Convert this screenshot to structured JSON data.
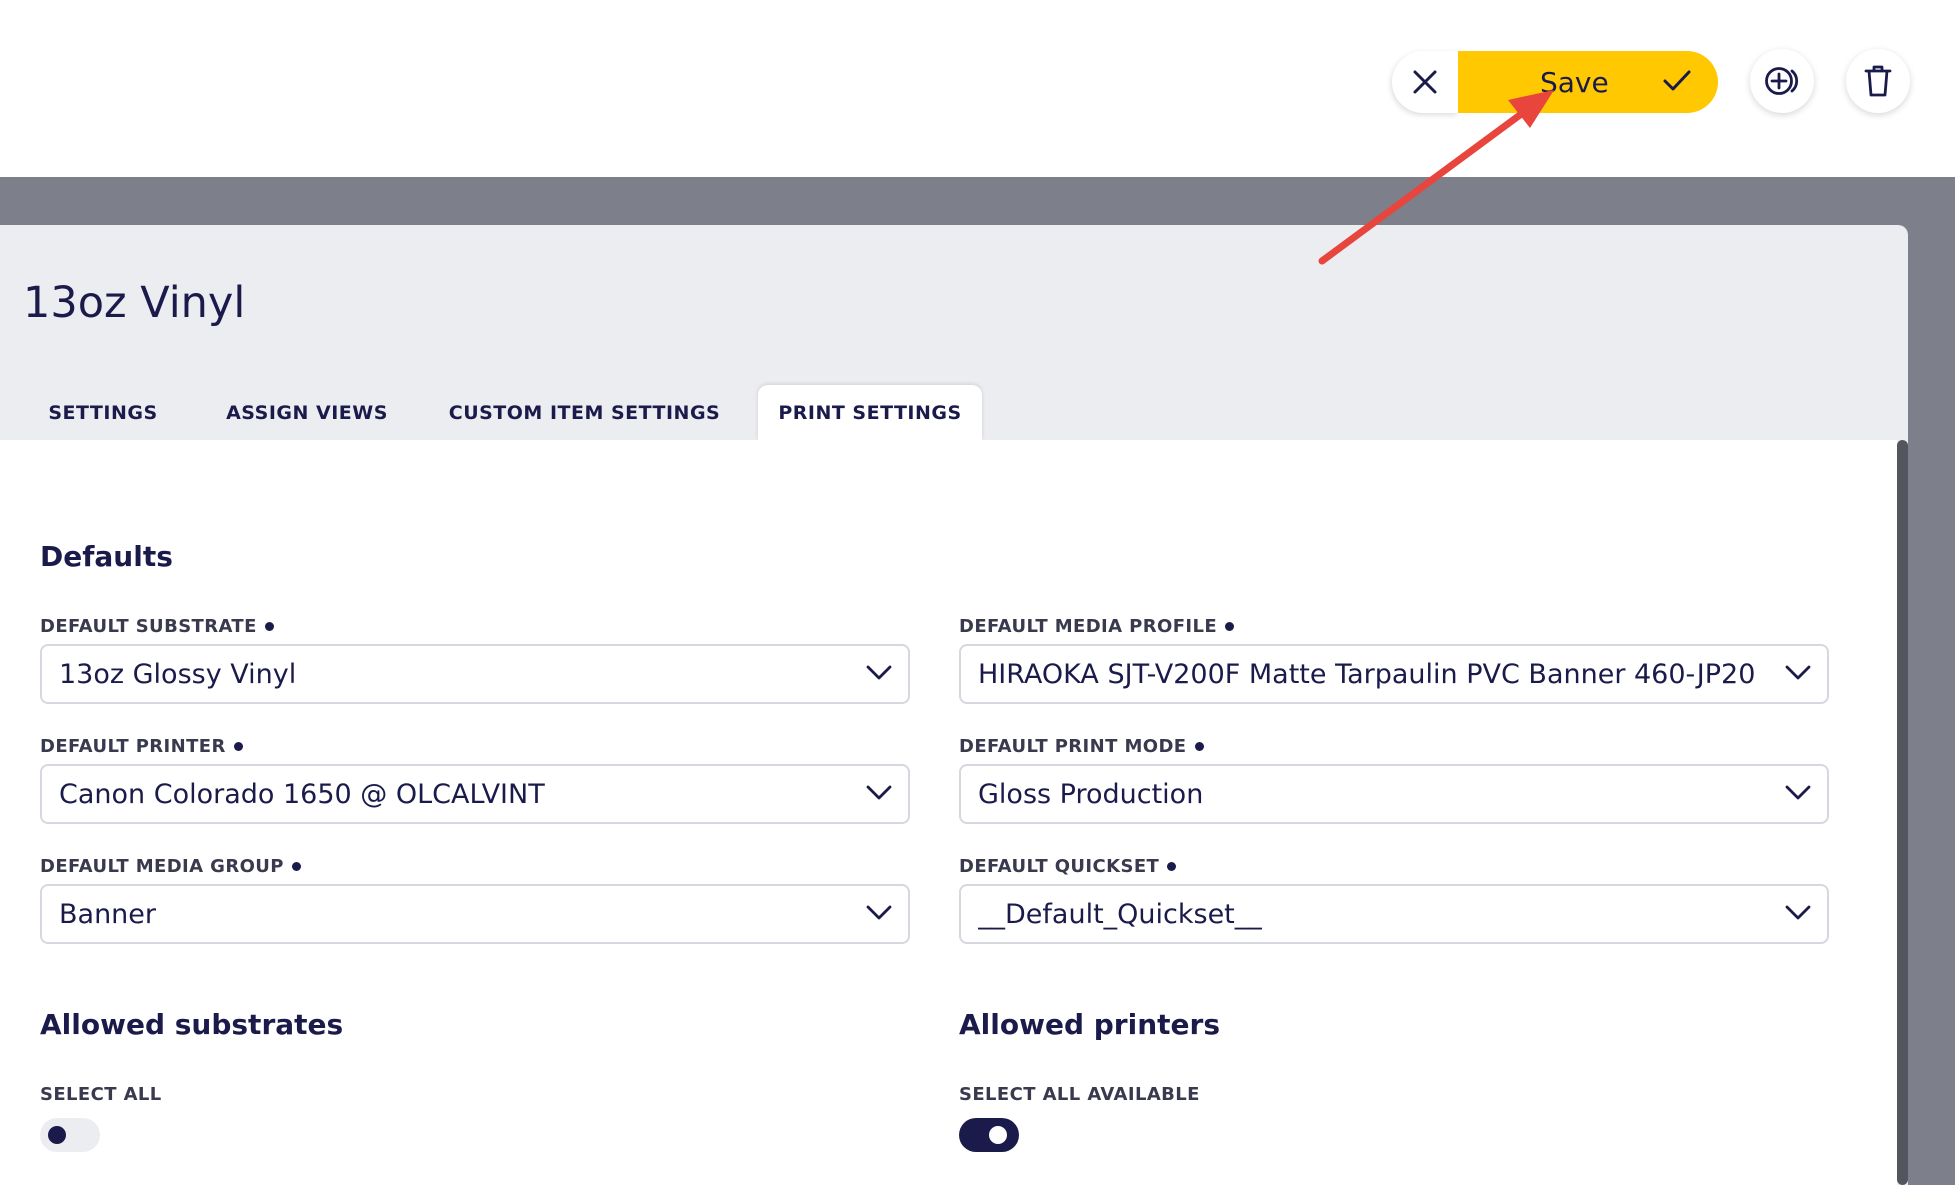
{
  "toolbar": {
    "cancel_icon": "close-icon",
    "save_label": "Save",
    "save_icon": "check-icon",
    "add_icon": "plus-circle-icon",
    "delete_icon": "trash-icon"
  },
  "page": {
    "title": "13oz Vinyl"
  },
  "tabs": [
    {
      "label": "SETTINGS",
      "active": false
    },
    {
      "label": "ASSIGN VIEWS",
      "active": false
    },
    {
      "label": "CUSTOM ITEM SETTINGS",
      "active": false
    },
    {
      "label": "PRINT SETTINGS",
      "active": true
    }
  ],
  "defaults": {
    "heading": "Defaults",
    "fields": {
      "substrate": {
        "label": "DEFAULT SUBSTRATE",
        "value": "13oz Glossy Vinyl"
      },
      "media_profile": {
        "label": "DEFAULT MEDIA PROFILE",
        "value": "HIRAOKA SJT-V200F Matte Tarpaulin PVC Banner 460-JP20..."
      },
      "printer": {
        "label": "DEFAULT PRINTER",
        "value": "Canon Colorado 1650 @ OLCALVINT"
      },
      "print_mode": {
        "label": "DEFAULT PRINT MODE",
        "value": "Gloss Production"
      },
      "media_group": {
        "label": "DEFAULT MEDIA GROUP",
        "value": "Banner"
      },
      "quickset": {
        "label": "DEFAULT QUICKSET",
        "value": "__Default_Quickset__"
      }
    }
  },
  "allowed_substrates": {
    "heading": "Allowed substrates",
    "toggle_label": "SELECT ALL",
    "toggle_on": false
  },
  "allowed_printers": {
    "heading": "Allowed printers",
    "toggle_label": "SELECT ALL AVAILABLE",
    "toggle_on": true
  },
  "colors": {
    "accent": "#ffc800",
    "navy": "#1b1b4b",
    "annotation_arrow": "#e8453c"
  }
}
